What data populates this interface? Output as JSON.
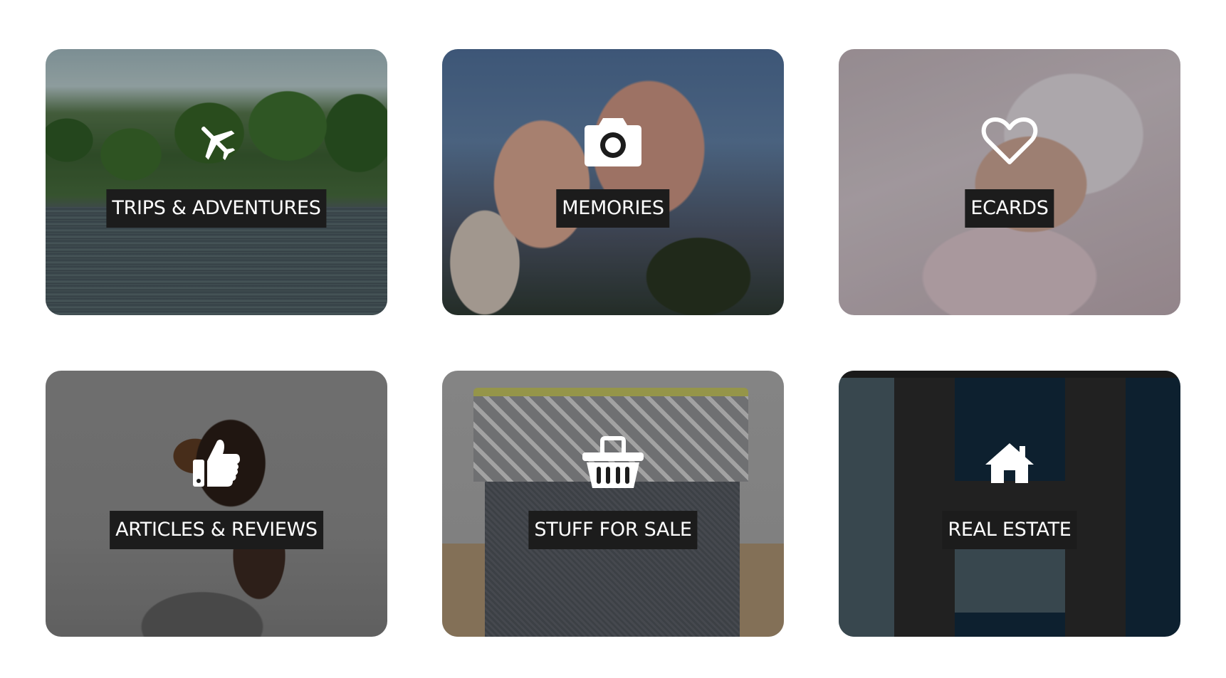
{
  "tiles": [
    {
      "label": "TRIPS & ADVENTURES",
      "icon": "airplane-icon"
    },
    {
      "label": "MEMORIES",
      "icon": "camera-icon"
    },
    {
      "label": "ECARDS",
      "icon": "heart-icon"
    },
    {
      "label": "ARTICLES & REVIEWS",
      "icon": "thumbs-up-icon"
    },
    {
      "label": "STUFF FOR SALE",
      "icon": "shopping-basket-icon"
    },
    {
      "label": "REAL ESTATE",
      "icon": "house-icon"
    }
  ],
  "colors": {
    "label_background": "#1c1c1c",
    "label_text": "#ffffff",
    "icon_color": "#ffffff",
    "page_background": "#ffffff"
  }
}
